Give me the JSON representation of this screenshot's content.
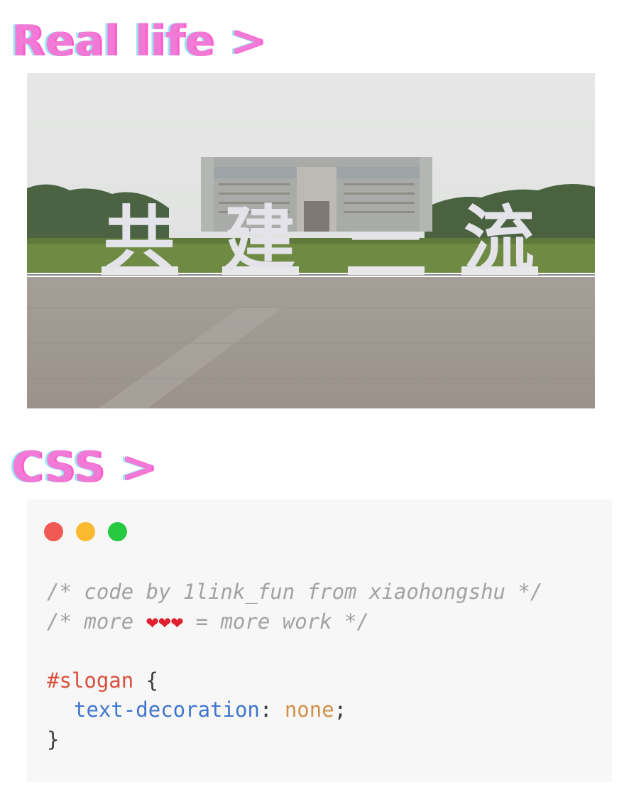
{
  "sections": {
    "real_life_heading": "Real life >",
    "css_heading": "CSS >"
  },
  "photo": {
    "sign_characters": [
      "共",
      "建",
      "一",
      "流"
    ]
  },
  "code_card": {
    "window_dots": [
      "#f05a53",
      "#fbb92f",
      "#27c941"
    ],
    "comment_1": "/* code by 1link_fun from xiaohongshu */",
    "comment_2_before": "/* more ",
    "comment_2_hearts": "❤❤❤",
    "comment_2_after": " = more work */",
    "selector": "#slogan",
    "open_brace": " {",
    "property": "text-decoration",
    "colon": ": ",
    "value": "none",
    "semicolon": ";",
    "close_brace": "}"
  },
  "colors": {
    "heading": "#f07ad6",
    "heading_shadow_cyan": "#9ae6f2",
    "selector": "#d9513e",
    "property": "#3f76cf",
    "value": "#d2914a",
    "comment": "#a2a2a2",
    "card_background": "#f7f7f7"
  }
}
